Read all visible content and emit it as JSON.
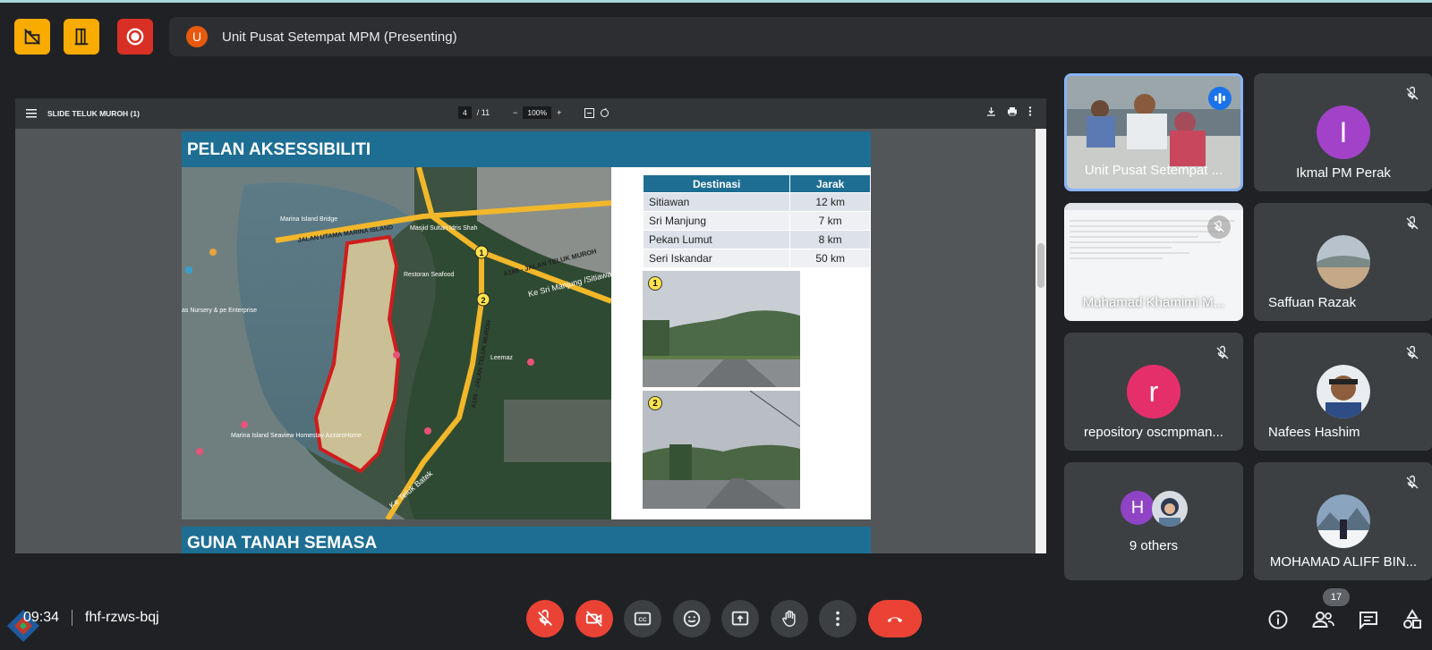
{
  "meeting": {
    "presenting_text": "Unit Pusat Setempat MPM (Presenting)",
    "presenter_initial": "U",
    "time": "09:34",
    "code": "fhf-rzws-bqj",
    "participant_count": "17"
  },
  "pdf": {
    "title": "SLIDE TELUK MUROH (1)",
    "page_current": "4",
    "page_total": "/ 11",
    "zoom": "100%"
  },
  "slide": {
    "heading": "PELAN AKSESSIBILITI",
    "next_heading": "GUNA TANAH SEMASA",
    "table_headers": [
      "Destinasi",
      "Jarak"
    ],
    "table_rows": [
      [
        "Sitiawan",
        "12 km"
      ],
      [
        "Sri Manjung",
        "7 km"
      ],
      [
        "Pekan Lumut",
        "8 km"
      ],
      [
        "Seri Iskandar",
        "50 km"
      ]
    ],
    "map_labels": {
      "road_main": "JALAN UTAMA MARINA ISLAND",
      "road_a186": "A186 - JALAN TELUK MUROH",
      "road_a186_v": "A186 - JALAN TELUK MUROH",
      "to_manjung": "Ke Sri Manjung /Sitiawan",
      "to_batek": "Ke Teluk Batek",
      "marina_bridge": "Marina Island Bridge",
      "masjid": "Masjid Sultan Idris Shah",
      "restoran": "Restoran Seafood",
      "nursery": "as Nursery & pe Enterprise",
      "homestay": "Marina Island Seaview Homestay AzzaroHome",
      "leemaz": "Leemaz",
      "marker1": "1",
      "marker2": "2"
    },
    "photo1_num": "1",
    "photo2_num": "2"
  },
  "participants": [
    {
      "name": "Unit Pusat Setempat ...",
      "type": "video"
    },
    {
      "name": "Ikmal PM Perak",
      "initial": "I",
      "color": "#a142c8"
    },
    {
      "name": "Muhamad Khamimi M...",
      "type": "screen"
    },
    {
      "name": "Saffuan Razak",
      "type": "photo"
    },
    {
      "name": "repository oscmpman...",
      "initial": "r",
      "color": "#e52f6b"
    },
    {
      "name": "Nafees Hashim",
      "type": "photo"
    },
    {
      "name": "9 others",
      "initial": "H",
      "color": "#8e44c4"
    },
    {
      "name": "MOHAMAD ALIFF BIN...",
      "type": "photo"
    }
  ]
}
